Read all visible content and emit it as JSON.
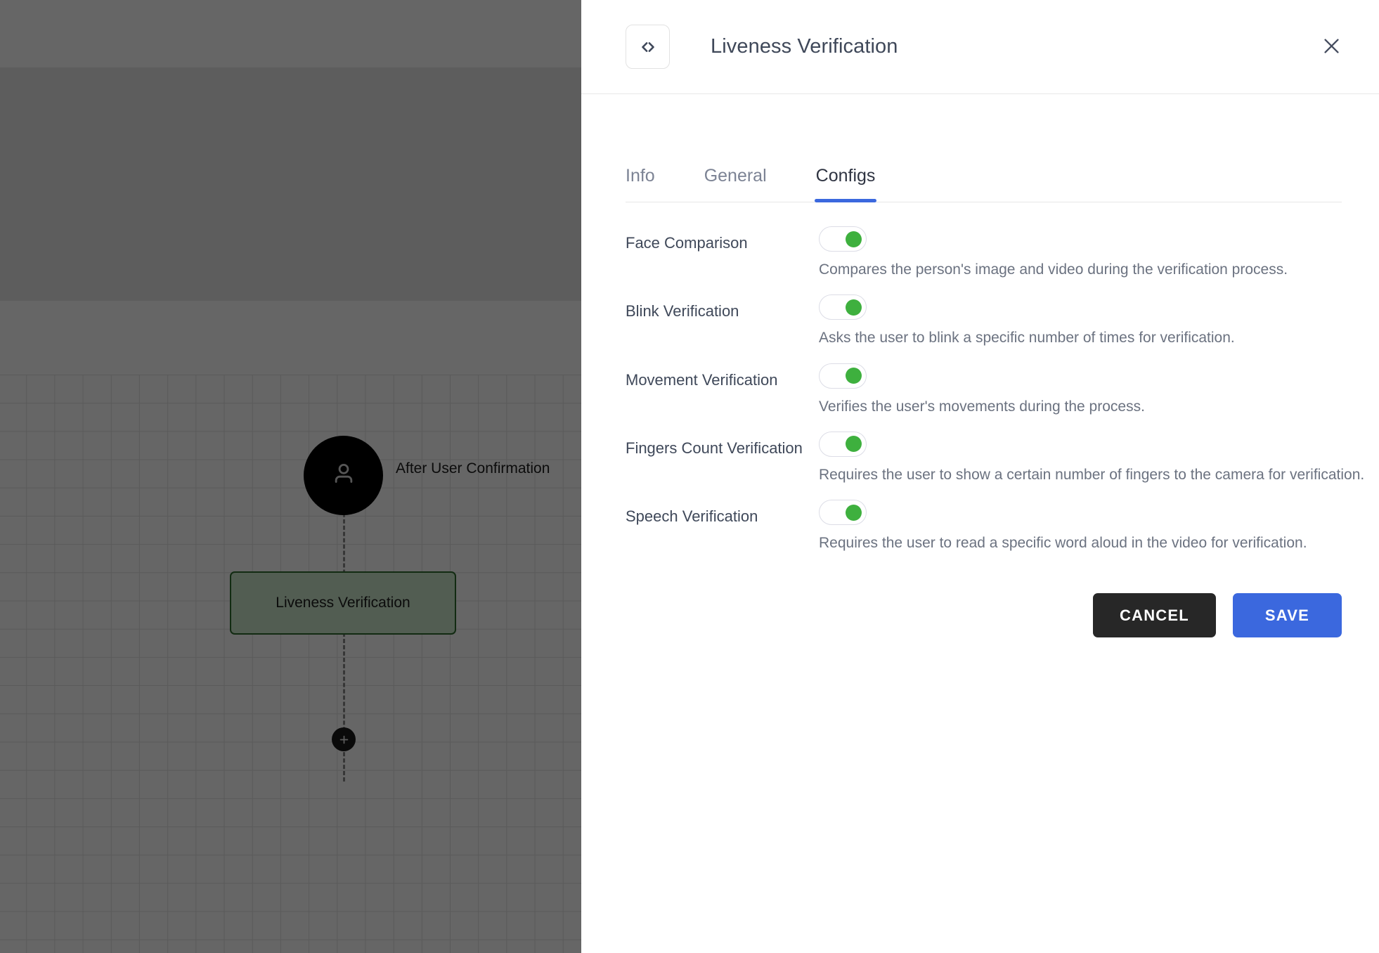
{
  "canvas": {
    "trigger_node": {
      "label": "After User Confirmation",
      "icon": "person-icon"
    },
    "step_node": {
      "label": "Liveness Verification"
    },
    "add_node_button": {
      "icon": "plus-icon"
    }
  },
  "panel": {
    "header": {
      "icon": "code-icon",
      "title": "Liveness Verification",
      "close_icon": "close-icon"
    },
    "tabs": [
      {
        "label": "Info",
        "active": false
      },
      {
        "label": "General",
        "active": false
      },
      {
        "label": "Configs",
        "active": true
      }
    ],
    "configs": [
      {
        "label": "Face Comparison",
        "enabled": true,
        "description": "Compares the person's image and video during the verification process."
      },
      {
        "label": "Blink Verification",
        "enabled": true,
        "description": "Asks the user to blink a specific number of times for verification."
      },
      {
        "label": "Movement Verification",
        "enabled": true,
        "description": "Verifies the user's movements during the process."
      },
      {
        "label": "Fingers Count Verification",
        "enabled": true,
        "description": "Requires the user to show a certain number of fingers to the camera for verification."
      },
      {
        "label": "Speech Verification",
        "enabled": true,
        "description": "Requires the user to read a specific word aloud in the video for verification."
      }
    ],
    "actions": {
      "cancel_label": "CANCEL",
      "save_label": "SAVE"
    }
  },
  "colors": {
    "accent_blue": "#3b68de",
    "toggle_on_green": "#3eb03e",
    "cancel_dark": "#272727",
    "node_border_green": "#2e6b2e",
    "text_slate": "#3f4859"
  }
}
